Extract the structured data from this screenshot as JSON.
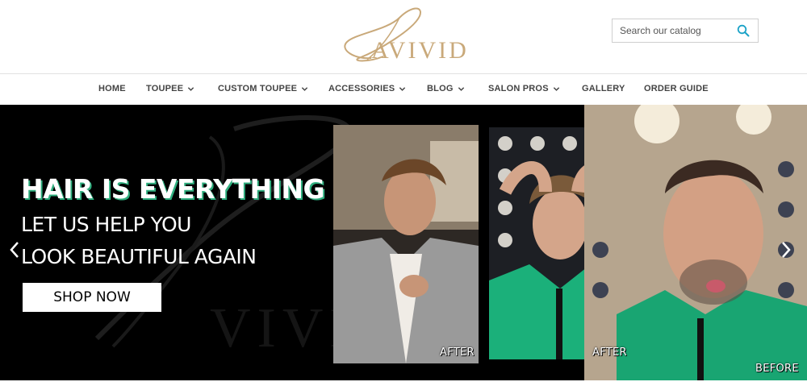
{
  "brand": {
    "logo_text": "AVIVID",
    "logo_color": "#c9a97a"
  },
  "search": {
    "placeholder": "Search our catalog",
    "icon": "search-icon",
    "icon_color": "#1aa2c7"
  },
  "nav": {
    "items": [
      {
        "label": "HOME",
        "has_dropdown": false
      },
      {
        "label": "TOUPEE",
        "has_dropdown": true
      },
      {
        "label": "CUSTOM TOUPEE",
        "has_dropdown": true
      },
      {
        "label": "ACCESSORIES",
        "has_dropdown": true
      },
      {
        "label": "BLOG",
        "has_dropdown": true
      },
      {
        "label": "SALON PROS",
        "has_dropdown": true
      },
      {
        "label": "GALLERY",
        "has_dropdown": false
      },
      {
        "label": "ORDER GUIDE",
        "has_dropdown": false
      }
    ]
  },
  "hero": {
    "headline": "HAIR IS EVERYTHING",
    "subline_1": "LET US HELP YOU",
    "subline_2": "LOOK BEAUTIFUL AGAIN",
    "cta_label": "SHOP NOW",
    "accent_color": "#2fae7e",
    "photos": [
      {
        "caption": "AFTER"
      },
      {
        "caption": "AFTER"
      },
      {
        "caption": "BEFORE"
      }
    ],
    "prev_icon": "chevron-left-icon",
    "next_icon": "chevron-right-icon"
  }
}
